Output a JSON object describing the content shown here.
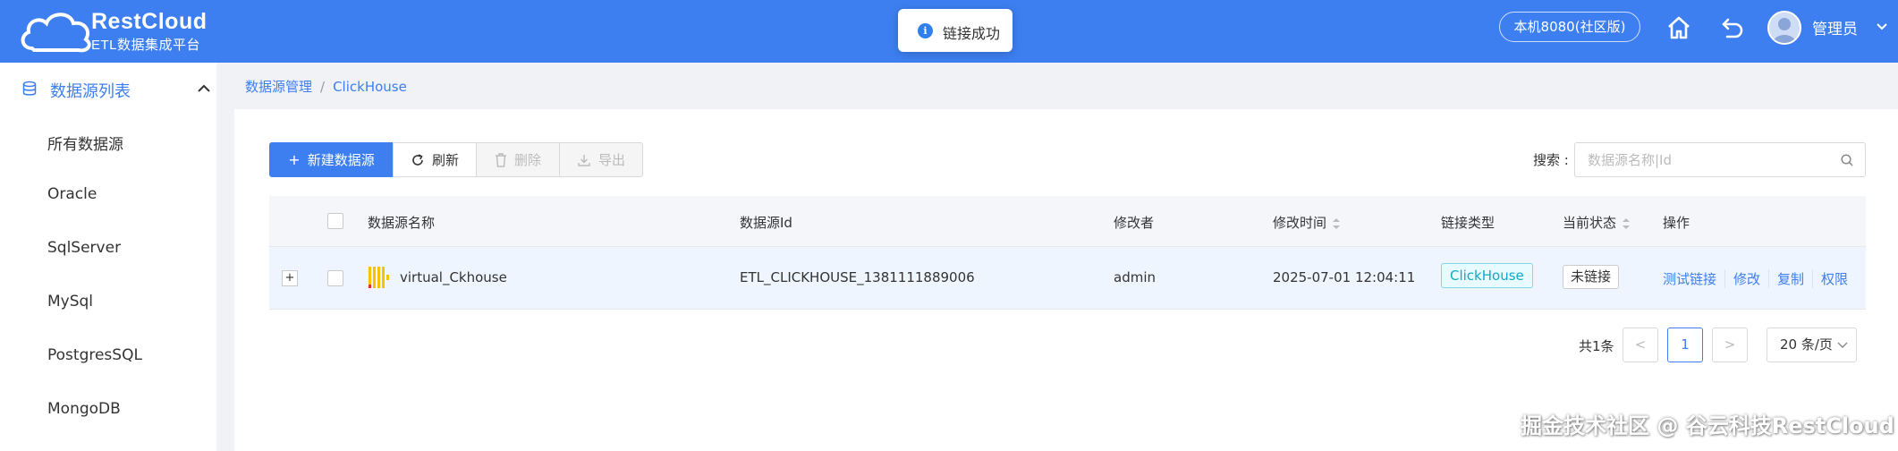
{
  "header": {
    "brand": "RestCloud",
    "subtitle": "ETL数据集成平台",
    "env_badge": "本机8080(社区版)",
    "user": "管理员",
    "toast": "链接成功",
    "toast_icon": "i",
    "bg_color": "#3d7ff0"
  },
  "sidebar": {
    "title": "数据源列表",
    "items": [
      {
        "label": "所有数据源"
      },
      {
        "label": "Oracle"
      },
      {
        "label": "SqlServer"
      },
      {
        "label": "MySql"
      },
      {
        "label": "PostgresSQL"
      },
      {
        "label": "MongoDB"
      }
    ]
  },
  "breadcrumb": {
    "items": [
      "数据源管理",
      "ClickHouse"
    ],
    "separator": "/"
  },
  "toolbar": {
    "new_label": "新建数据源",
    "refresh_label": "刷新",
    "delete_label": "删除",
    "export_label": "导出"
  },
  "search": {
    "label": "搜索 :",
    "placeholder": "数据源名称|Id"
  },
  "table": {
    "columns": [
      "数据源名称",
      "数据源Id",
      "修改者",
      "修改时间",
      "链接类型",
      "当前状态",
      "操作"
    ],
    "rows": [
      {
        "expand": "+",
        "name": "virtual_Ckhouse",
        "id": "ETL_CLICKHOUSE_1381111889006",
        "modifier": "admin",
        "modified_time": "2025-07-01 12:04:11",
        "link_type": "ClickHouse",
        "status": "未链接",
        "actions": [
          "测试链接",
          "修改",
          "复制",
          "权限"
        ]
      }
    ]
  },
  "pagination": {
    "total": "共1条",
    "prev": "<",
    "current": "1",
    "next": ">",
    "page_size": "20 条/页"
  },
  "watermark": "掘金技术社区 @ 谷云科技RestCloud"
}
